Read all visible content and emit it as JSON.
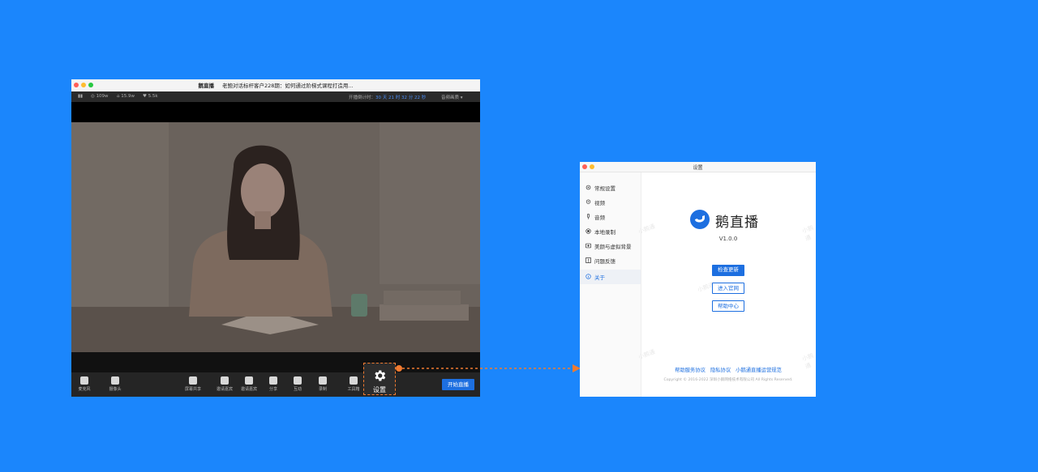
{
  "live_window": {
    "app_name": "鹅直播",
    "course_title": "老鲍对话标杆客户228期：如何通过阶梯式课程打造用...",
    "status": {
      "online": "109w",
      "viewers": "15.9w",
      "likes": "5.5k",
      "countdown_label": "开播倒计时：",
      "countdown": "30 天 21 时 32 分 22 秒",
      "quality": "音频画质"
    },
    "controls": [
      "麦克风",
      "摄像头",
      "屏幕共享",
      "邀请嘉宾",
      "分享",
      "互动",
      "录制",
      "工具箱"
    ],
    "start_button": "开始直播"
  },
  "settings_callout": {
    "label": "设置"
  },
  "settings_window": {
    "title": "设置",
    "nav": [
      "常规设置",
      "视频",
      "音频",
      "本地录制",
      "美颜与虚拟背景",
      "问题反馈",
      "关于"
    ],
    "active_nav_index": 6,
    "brand": "鹅直播",
    "version": "V1.0.0",
    "buttons": {
      "check_update": "检查更新",
      "official_site": "进入官网",
      "help_center": "帮助中心"
    },
    "footer_links": [
      "帮助服务协议",
      "隐私协议",
      "小鹅通直播运营规范"
    ],
    "copyright": "Copyright © 2016-2022 深圳小鹅网络技术有限公司 All Rights Reserved."
  },
  "colors": {
    "background": "#1b86fc",
    "accent": "#1d6fe0",
    "callout": "#f07a30"
  }
}
